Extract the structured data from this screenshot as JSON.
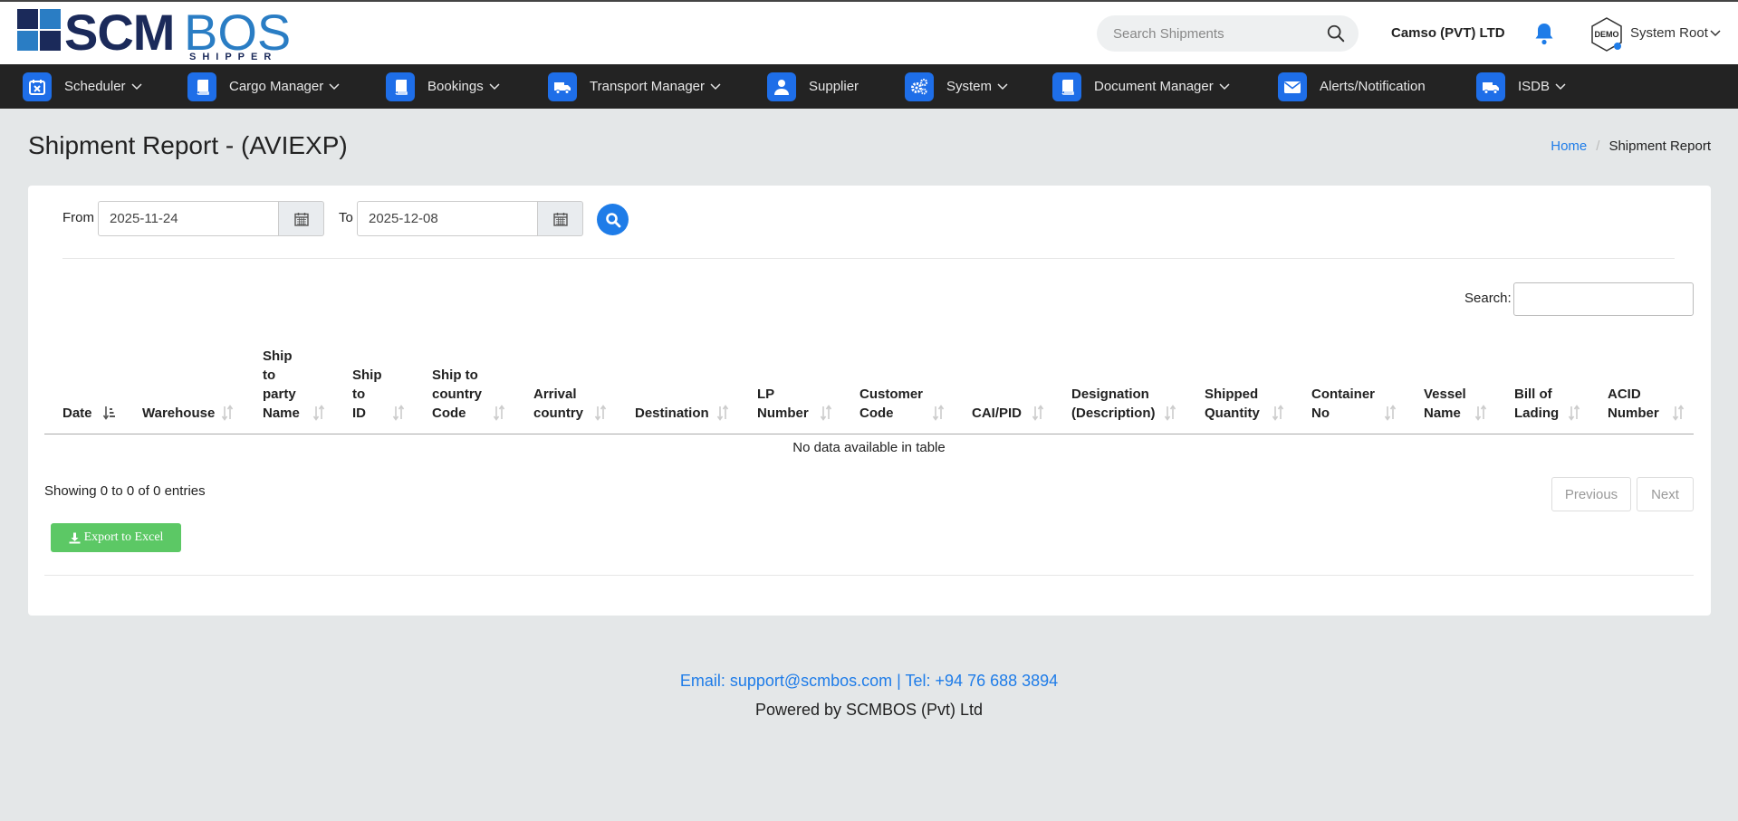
{
  "header": {
    "logo": {
      "text_main": "SCM",
      "text_accent": "BOS",
      "tagline": "SHIPPER"
    },
    "search": {
      "placeholder": "Search Shipments"
    },
    "company": "Camso (PVT) LTD",
    "demo_badge": "DEMO",
    "user": "System Root"
  },
  "nav": [
    {
      "label": "Scheduler",
      "icon": "calendar-icon",
      "dropdown": true
    },
    {
      "label": "Cargo Manager",
      "icon": "book-icon",
      "dropdown": true
    },
    {
      "label": "Bookings",
      "icon": "book-icon",
      "dropdown": true
    },
    {
      "label": "Transport Manager",
      "icon": "truck-icon",
      "dropdown": true
    },
    {
      "label": "Supplier",
      "icon": "user-icon",
      "dropdown": false
    },
    {
      "label": "System",
      "icon": "gears-icon",
      "dropdown": true
    },
    {
      "label": "Document Manager",
      "icon": "book-icon",
      "dropdown": true
    },
    {
      "label": "Alerts/Notification",
      "icon": "envelope-icon",
      "dropdown": false
    },
    {
      "label": "ISDB",
      "icon": "truck-icon",
      "dropdown": true
    }
  ],
  "page": {
    "title": "Shipment Report - (AVIEXP)",
    "breadcrumb": {
      "home": "Home",
      "separator": "/",
      "current": "Shipment Report"
    }
  },
  "filters": {
    "from_label": "From",
    "from_value": "2025-11-24",
    "to_label": "To",
    "to_value": "2025-12-08"
  },
  "table": {
    "search_label": "Search:",
    "columns": [
      {
        "label": "Date",
        "lines": [
          "Date"
        ]
      },
      {
        "label": "Warehouse",
        "lines": [
          "Warehouse"
        ]
      },
      {
        "label": "Ship to party Name",
        "lines": [
          "Ship",
          "to",
          "party",
          "Name"
        ]
      },
      {
        "label": "Ship to ID",
        "lines": [
          "Ship",
          "to",
          "ID"
        ]
      },
      {
        "label": "Ship to country Code",
        "lines": [
          "Ship to",
          "country",
          "Code"
        ]
      },
      {
        "label": "Arrival country",
        "lines": [
          "Arrival",
          "country"
        ]
      },
      {
        "label": "Destination",
        "lines": [
          "Destination"
        ]
      },
      {
        "label": "LP Number",
        "lines": [
          "LP",
          "Number"
        ]
      },
      {
        "label": "Customer Code",
        "lines": [
          "Customer",
          "Code"
        ]
      },
      {
        "label": "CAI/PID",
        "lines": [
          "CAI/PID"
        ]
      },
      {
        "label": "Designation (Description)",
        "lines": [
          "Designation",
          "(Description)"
        ]
      },
      {
        "label": "Shipped Quantity",
        "lines": [
          "Shipped",
          "Quantity"
        ]
      },
      {
        "label": "Container No",
        "lines": [
          "Container",
          "No"
        ]
      },
      {
        "label": "Vessel Name",
        "lines": [
          "Vessel",
          "Name"
        ]
      },
      {
        "label": "Bill of Lading",
        "lines": [
          "Bill of",
          "Lading"
        ]
      },
      {
        "label": "ACID Number",
        "lines": [
          "ACID",
          "Number"
        ]
      }
    ],
    "empty_message": "No data available in table",
    "info": "Showing 0 to 0 of 0 entries",
    "previous": "Previous",
    "next": "Next",
    "export": "Export to Excel"
  },
  "footer": {
    "contact": "Email: support@scmbos.com | Tel: +94 76 688 3894",
    "powered": "Powered by SCMBOS (Pvt) Ltd"
  },
  "colors": {
    "nav_bg": "#232323",
    "accent": "#1e7ce8",
    "export": "#5cc865",
    "page_bg": "#e4e7e8"
  }
}
